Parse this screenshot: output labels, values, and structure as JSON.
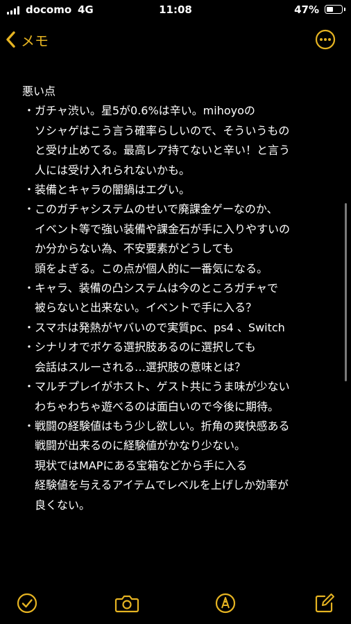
{
  "status_bar": {
    "carrier": "docomo",
    "network": "4G",
    "time": "11:08",
    "battery_percent": "47%",
    "battery_level": 0.47
  },
  "nav": {
    "back_label": "メモ",
    "accent_color": "#e6b422",
    "more_icon": "ellipsis-circle-icon"
  },
  "note": {
    "heading": "悪い点",
    "bullet_symbol": "・",
    "bullets": [
      {
        "lines": [
          "ガチャ渋い。星5が0.6%は辛い。mihoyoの",
          "ソシャゲはこう言う確率らしいので、そういうもの",
          "と受け止めてる。最高レア持てないと辛い！と言う",
          "人には受け入れられないかも。"
        ]
      },
      {
        "lines": [
          "装備とキャラの闇鍋はエグい。"
        ]
      },
      {
        "lines": [
          "このガチャシステムのせいで廃課金ゲーなのか、",
          "イベント等で強い装備や課金石が手に入りやすいの",
          "か分からない為、不安要素がどうしても",
          "頭をよぎる。この点が個人的に一番気になる。"
        ]
      },
      {
        "lines": [
          "キャラ、装備の凸システムは今のところガチャで",
          "被らないと出来ない。イベントで手に入る？"
        ]
      },
      {
        "lines": [
          "スマホは発熱がヤバいので実質pc、ps4 、Switch"
        ]
      },
      {
        "lines": [
          "シナリオでボケる選択肢あるのに選択しても",
          "会話はスルーされる…選択肢の意味とは？"
        ]
      },
      {
        "lines": [
          "マルチプレイがホスト、ゲスト共にうま味が少ない",
          "わちゃわちゃ遊べるのは面白いので今後に期待。"
        ]
      },
      {
        "lines": [
          "戦闘の経験値はもう少し欲しい。折角の爽快感ある",
          "戦闘が出来るのに経験値がかなり少ない。",
          "現状ではMAPにある宝箱などから手に入る",
          "経験値を与えるアイテムでレベルを上げしか効率が",
          "良くない。"
        ]
      }
    ]
  },
  "toolbar": {
    "items": [
      {
        "icon": "checklist-icon"
      },
      {
        "icon": "camera-icon"
      },
      {
        "icon": "markup-pen-icon"
      },
      {
        "icon": "compose-icon"
      }
    ]
  }
}
